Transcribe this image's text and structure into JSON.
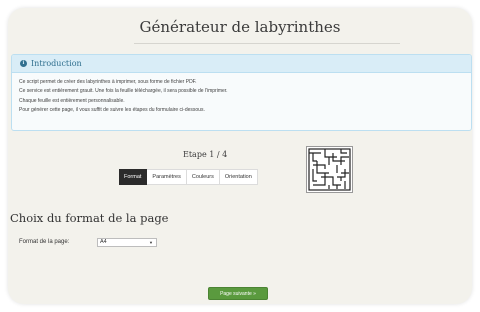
{
  "header": {
    "title": "Générateur de labyrinthes"
  },
  "intro": {
    "heading": "Introduction",
    "icon": "info-circle-icon",
    "lines": [
      "Ce script permet de créer des labyrinthes à imprimer, sous forme de fichier PDF.",
      "Ce service est entièrement grauit. Une fois la feuille téléchargée, il sera possible de l'imprimer.",
      "Chaque feuille est entièrement personnalisable.",
      "Pour générer cette page, il vous suffit de suivre les étapes du formulaire ci-dessous."
    ]
  },
  "wizard": {
    "step_label": "Etape 1 / 4",
    "tabs": [
      {
        "label": "Format",
        "active": true
      },
      {
        "label": "Paramètres",
        "active": false
      },
      {
        "label": "Couleurs",
        "active": false
      },
      {
        "label": "Orientation",
        "active": false
      }
    ]
  },
  "form": {
    "section_title": "Choix du format de la page",
    "format_label": "Format de la page:",
    "format_value": "A4"
  },
  "footer": {
    "next_label": "Page suivante »"
  },
  "colors": {
    "card_bg": "#f3f2ec",
    "info_bg": "#d9edf7",
    "info_text": "#31708f",
    "active_tab": "#2b2b2b",
    "next_button": "#5a9a3e"
  }
}
